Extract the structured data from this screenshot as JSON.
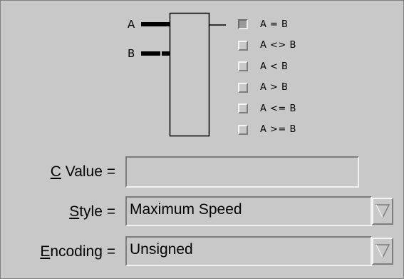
{
  "diagram": {
    "port_a": "A",
    "port_b": "B",
    "operations": [
      {
        "label": "A = B",
        "selected": true
      },
      {
        "label": "A <> B",
        "selected": false
      },
      {
        "label": "A < B",
        "selected": false
      },
      {
        "label": "A > B",
        "selected": false
      },
      {
        "label": "A <= B",
        "selected": false
      },
      {
        "label": "A >= B",
        "selected": false
      }
    ]
  },
  "form": {
    "c_value": {
      "mnemonic": "C",
      "label_rest": " Value =",
      "value": ""
    },
    "style": {
      "mnemonic": "S",
      "label_rest": "tyle =",
      "value": "Maximum Speed",
      "icon": "chevron-down-icon"
    },
    "encoding": {
      "mnemonic": "E",
      "label_rest": "ncoding =",
      "value": "Unsigned",
      "icon": "chevron-down-icon"
    }
  },
  "colors": {
    "background": "#c8c8c8",
    "shadow": "#7e7e7e",
    "highlight": "#f2f2f2",
    "selected_radio": "#9a9a9a"
  }
}
